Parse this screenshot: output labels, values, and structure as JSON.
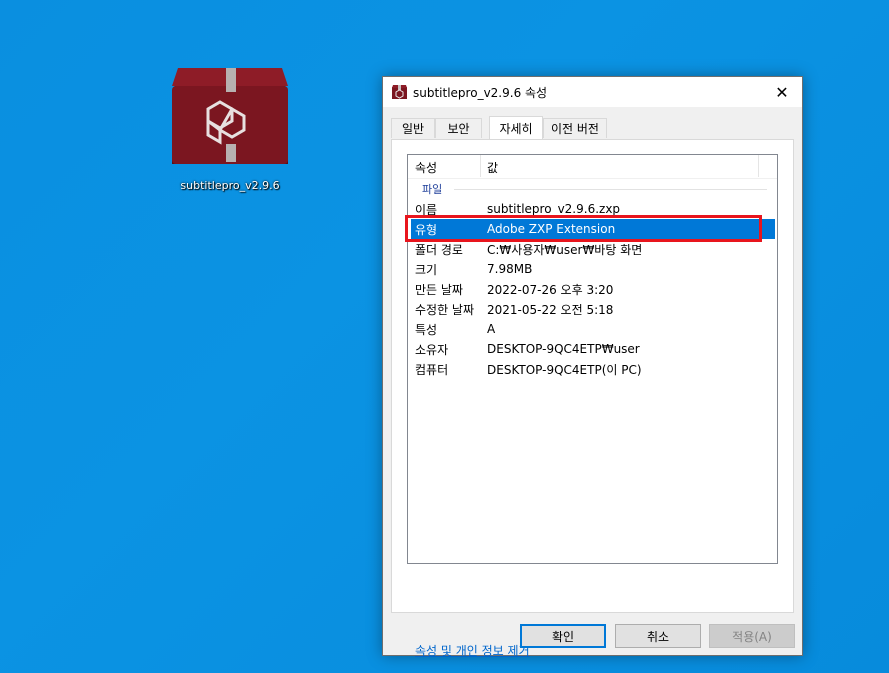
{
  "desktop": {
    "icon_label": "subtitlepro_v2.9.6"
  },
  "dialog": {
    "title": "subtitlepro_v2.9.6 속성",
    "close_glyph": "✕",
    "tabs": [
      {
        "label": "일반"
      },
      {
        "label": "보안"
      },
      {
        "label": "자세히"
      },
      {
        "label": "이전 버전"
      }
    ],
    "list": {
      "col_property": "속성",
      "col_value": "값",
      "group_label": "파일",
      "rows": [
        {
          "key": "이름",
          "value": "subtitlepro_v2.9.6.zxp"
        },
        {
          "key": "유형",
          "value": "Adobe ZXP Extension"
        },
        {
          "key": "폴더 경로",
          "value": "C:₩사용자₩user₩바탕 화면"
        },
        {
          "key": "크기",
          "value": "7.98MB"
        },
        {
          "key": "만든 날짜",
          "value": "2022-07-26 오후 3:20"
        },
        {
          "key": "수정한 날짜",
          "value": "2021-05-22 오전 5:18"
        },
        {
          "key": "특성",
          "value": "A"
        },
        {
          "key": "소유자",
          "value": "DESKTOP-9QC4ETP₩user"
        },
        {
          "key": "컴퓨터",
          "value": "DESKTOP-9QC4ETP(이 PC)"
        }
      ],
      "selected_row": "유형"
    },
    "remove_link": "속성 및 개인 정보 제거",
    "buttons": {
      "ok": "확인",
      "cancel": "취소",
      "apply": "적용(A)"
    }
  },
  "colors": {
    "desktop_bg": "#0a8fe0",
    "selection": "#0078d7",
    "highlight_box": "#e8151d",
    "link": "#0066cc"
  }
}
